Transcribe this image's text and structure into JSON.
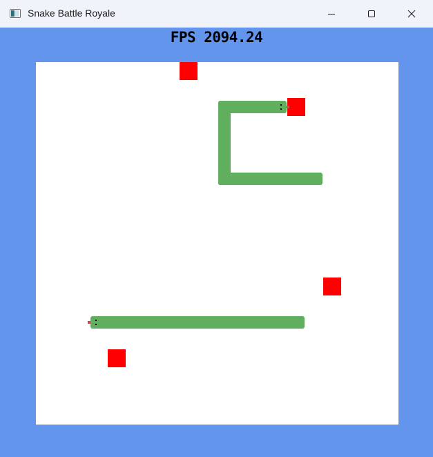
{
  "window": {
    "title": "Snake Battle Royale",
    "buttons": {
      "minimize": "minimize-icon",
      "maximize": "maximize-icon",
      "close": "close-icon"
    }
  },
  "hud": {
    "fps_text": "FPS 2094.24"
  },
  "colors": {
    "background": "#6495ED",
    "board": "#FFFFFF",
    "snake": "#5FAF5F",
    "food": "#FF0000",
    "tongue": "#C05050",
    "eyes": "#000000"
  },
  "game": {
    "cell_size": 26,
    "grid": [
      20,
      20
    ],
    "food": [
      [
        8,
        0
      ],
      [
        14,
        2
      ],
      [
        16,
        12
      ],
      [
        4,
        16
      ]
    ],
    "snakes": [
      {
        "direction": "right",
        "cells": [
          [
            13,
            2
          ],
          [
            12,
            2
          ],
          [
            11,
            2
          ],
          [
            10,
            2
          ],
          [
            10,
            3
          ],
          [
            10,
            4
          ],
          [
            10,
            5
          ],
          [
            10,
            6
          ],
          [
            11,
            6
          ],
          [
            12,
            6
          ],
          [
            13,
            6
          ],
          [
            14,
            6
          ],
          [
            15,
            6
          ]
        ]
      },
      {
        "direction": "left",
        "cells": [
          [
            3,
            14
          ],
          [
            4,
            14
          ],
          [
            5,
            14
          ],
          [
            6,
            14
          ],
          [
            7,
            14
          ],
          [
            8,
            14
          ],
          [
            9,
            14
          ],
          [
            10,
            14
          ],
          [
            11,
            14
          ],
          [
            12,
            14
          ],
          [
            13,
            14
          ],
          [
            14,
            14
          ]
        ]
      }
    ]
  }
}
